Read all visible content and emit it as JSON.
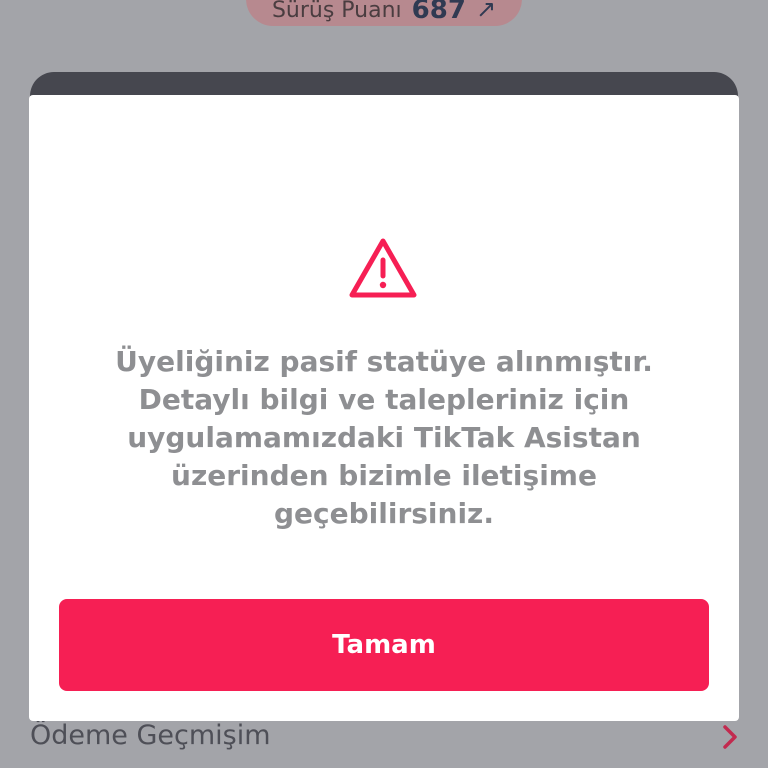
{
  "background": {
    "score_label": "Sürüş Puanı",
    "score_value": "687",
    "score_trend_icon": "trend-up-arrow-icon",
    "menu_row_label": "Ödeme Geçmişim",
    "menu_row_icon": "chevron-right-icon"
  },
  "modal": {
    "icon": "warning-triangle-icon",
    "message_lines": [
      "Üyeliğiniz pasif statüye alınmıştır.",
      "Detaylı bilgi ve talepleriniz için",
      "uygulamamızdaki TikTak Asistan",
      "üzerinden bizimle iletişime",
      "geçebilirsiniz."
    ],
    "button_label": "Tamam"
  },
  "colors": {
    "accent": "#f61f54",
    "overlay": "#a3a4a9",
    "message_text": "#8e8f92"
  }
}
